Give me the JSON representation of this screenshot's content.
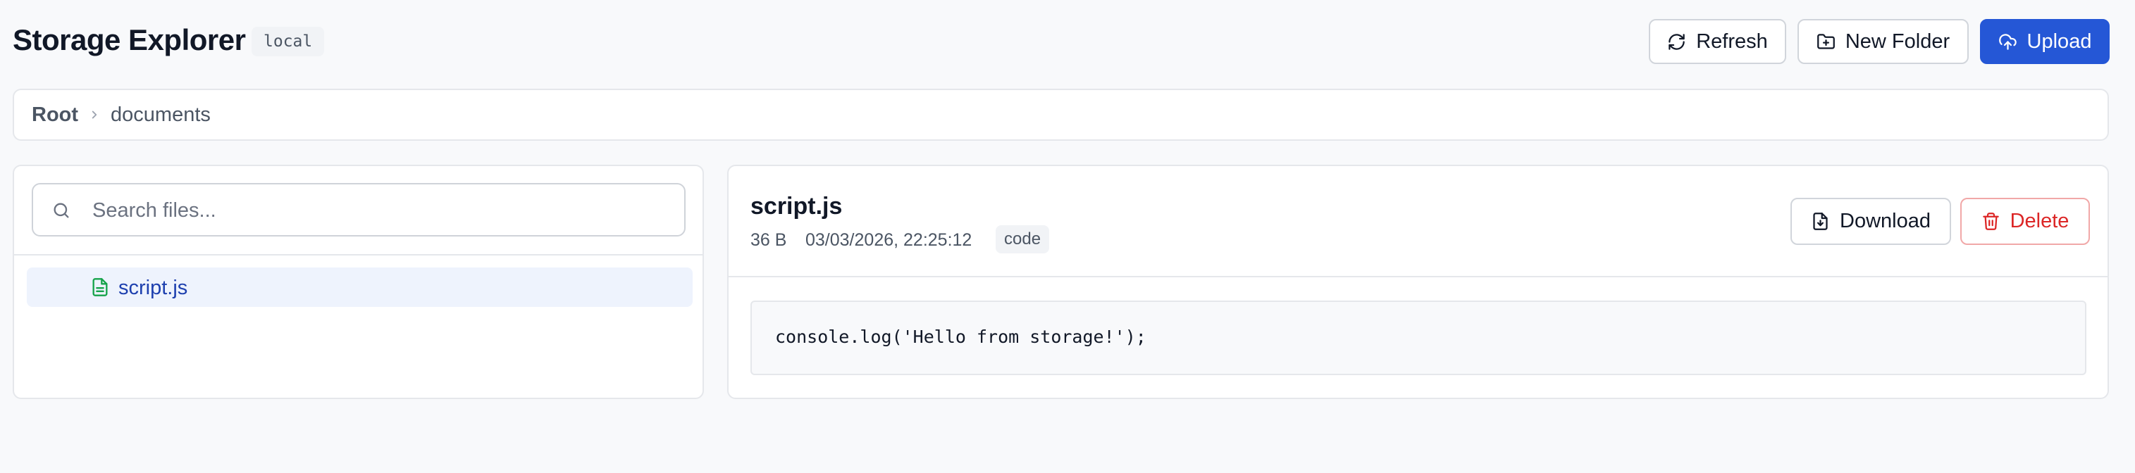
{
  "header": {
    "title": "Storage Explorer",
    "env_badge": "local",
    "buttons": {
      "refresh": "Refresh",
      "new_folder": "New Folder",
      "upload": "Upload"
    }
  },
  "breadcrumb": {
    "root": "Root",
    "current": "documents"
  },
  "sidebar": {
    "search_placeholder": "Search files...",
    "search_value": "",
    "files": [
      {
        "name": "script.js",
        "icon": "file-text-icon",
        "selected": true
      }
    ]
  },
  "preview": {
    "file_name": "script.js",
    "size": "36 B",
    "modified": "03/03/2026, 22:25:12",
    "type": "code",
    "actions": {
      "download": "Download",
      "delete": "Delete"
    },
    "content": "console.log('Hello from storage!');"
  },
  "colors": {
    "primary": "#2557d6",
    "danger": "#dc2626",
    "selected_bg": "#eef3fd",
    "file_icon": "#16a34a",
    "page_bg": "#f8f9fb"
  }
}
